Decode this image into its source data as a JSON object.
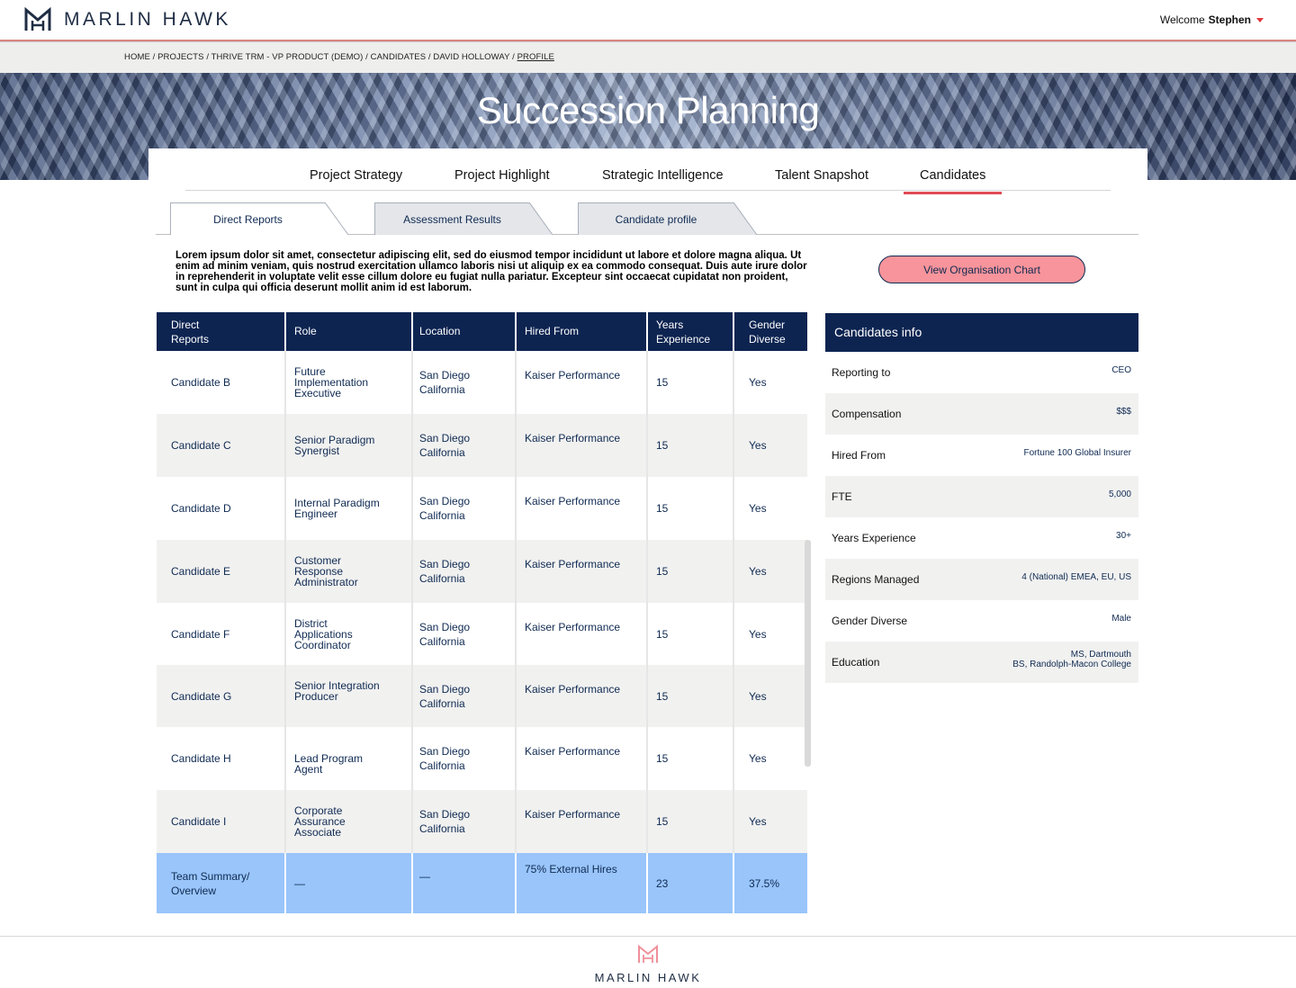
{
  "header": {
    "brand": "MARLIN HAWK",
    "welcome_prefix": "Welcome",
    "user_name": "Stephen"
  },
  "breadcrumb": {
    "items": [
      "HOME",
      "PROJECTS",
      "THRIVE TRM - VP PRODUCT (DEMO)",
      "CANDIDATES",
      "DAVID HOLLOWAY",
      "PROFILE"
    ],
    "separator": " / "
  },
  "hero": {
    "title": "Succession Planning"
  },
  "nav": {
    "tabs": [
      {
        "label": "Project Strategy"
      },
      {
        "label": "Project Highlight"
      },
      {
        "label": "Strategic Intelligence"
      },
      {
        "label": "Talent Snapshot"
      },
      {
        "label": "Candidates"
      }
    ],
    "active": "Candidates"
  },
  "subtabs": {
    "tabs": [
      {
        "label": "Direct Reports"
      },
      {
        "label": "Assessment Results"
      },
      {
        "label": "Candidate profile"
      }
    ],
    "active": "Direct Reports"
  },
  "intro_text": "Lorem ipsum dolor sit amet, consectetur adipiscing elit, sed do eiusmod tempor incididunt ut labore et dolore magna aliqua. Ut enim ad minim veniam, quis nostrud exercitation ullamco laboris nisi ut aliquip ex ea commodo consequat. Duis aute irure dolor in reprehenderit in voluptate velit esse cillum dolore eu fugiat nulla pariatur. Excepteur sint occaecat cupidatat non proident, sunt in culpa qui officia deserunt mollit anim id est laborum.",
  "org_chart_button": "View Organisation Chart",
  "table": {
    "headers": [
      "Direct Reports",
      "Role",
      "Location",
      "Hired From",
      "Years Experience",
      "Gender Diverse"
    ],
    "rows": [
      {
        "name": "Candidate B",
        "role": "Future Implementation Executive",
        "location": "San Diego California",
        "hired_from": "Kaiser Performance",
        "years": "15",
        "diverse": "Yes"
      },
      {
        "name": "Candidate C",
        "role": "Senior Paradigm Synergist",
        "location": "San Diego California",
        "hired_from": "Kaiser Performance",
        "years": "15",
        "diverse": "Yes"
      },
      {
        "name": "Candidate D",
        "role": "Internal Paradigm Engineer",
        "location": "San Diego California",
        "hired_from": "Kaiser Performance",
        "years": "15",
        "diverse": "Yes"
      },
      {
        "name": "Candidate E",
        "role": "Customer Response Administrator",
        "location": "San Diego California",
        "hired_from": "Kaiser Performance",
        "years": "15",
        "diverse": "Yes"
      },
      {
        "name": "Candidate F",
        "role": "District Applications Coordinator",
        "location": "San Diego California",
        "hired_from": "Kaiser Performance",
        "years": "15",
        "diverse": "Yes"
      },
      {
        "name": "Candidate G",
        "role": "Senior Integration Producer",
        "location": "San Diego California",
        "hired_from": "Kaiser Performance",
        "years": "15",
        "diverse": "Yes"
      },
      {
        "name": "Candidate H",
        "role": "Lead Program Agent",
        "location": "San Diego California",
        "hired_from": "Kaiser Performance",
        "years": "15",
        "diverse": "Yes"
      },
      {
        "name": "Candidate I",
        "role": "Corporate Assurance Associate",
        "location": "San Diego California",
        "hired_from": "Kaiser Performance",
        "years": "15",
        "diverse": "Yes"
      }
    ],
    "summary": {
      "name": "Team Summary/ Overview",
      "role": "—",
      "location": "—",
      "hired_from": "75% External Hires",
      "years": "23",
      "diverse": "37.5%"
    }
  },
  "info_panel": {
    "title": "Candidates info",
    "rows": [
      {
        "label": "Reporting to",
        "value": "CEO"
      },
      {
        "label": "Compensation",
        "value": "$$$"
      },
      {
        "label": "Hired From",
        "value": "Fortune 100 Global Insurer"
      },
      {
        "label": "FTE",
        "value": "5,000"
      },
      {
        "label": "Years Experience",
        "value": "30+"
      },
      {
        "label": "Regions Managed",
        "value": "4 (National) EMEA, EU, US"
      },
      {
        "label": "Gender Diverse",
        "value": "Male"
      },
      {
        "label": "Education",
        "value": "MS, Dartmouth",
        "value2": "BS, Randolph-Macon College"
      }
    ]
  },
  "footer": {
    "brand": "MARLIN HAWK"
  },
  "colors": {
    "navy": "#0d2451",
    "accent_red": "#e04b56",
    "button_pink": "#f8949b",
    "summary_blue": "#99c5fb",
    "alt_row": "#f1f1f0"
  }
}
